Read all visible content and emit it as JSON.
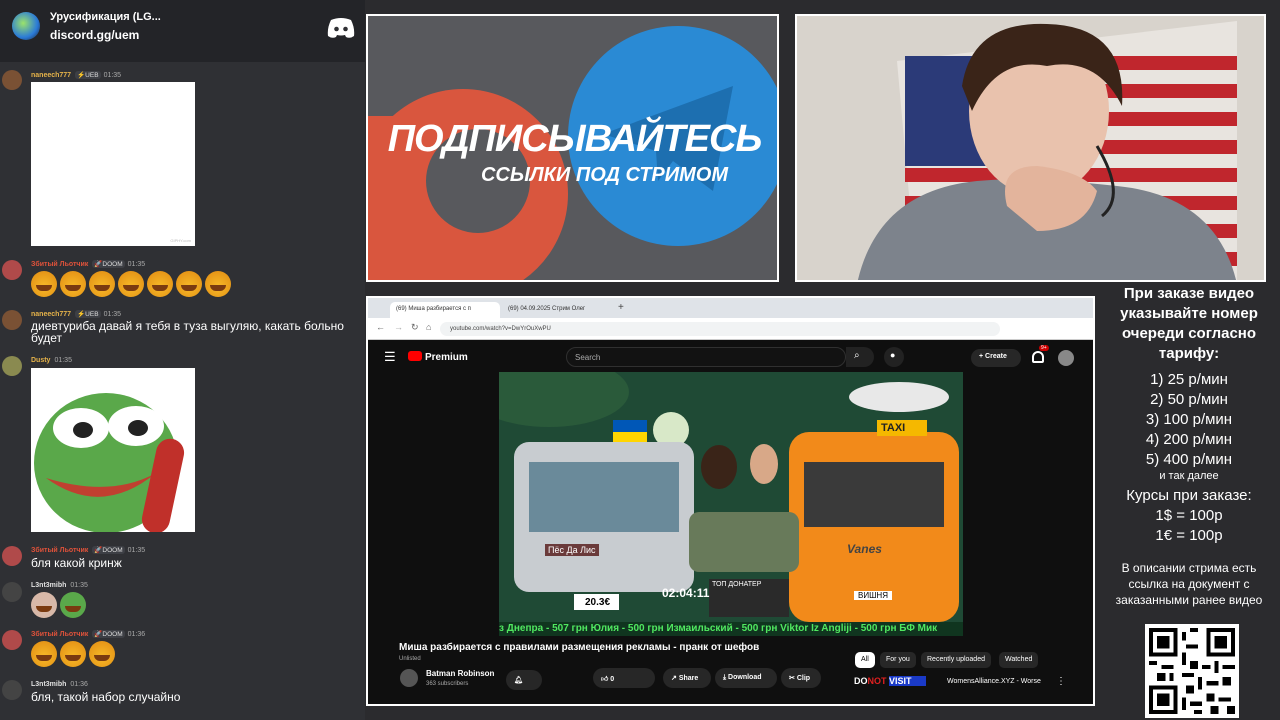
{
  "chat": {
    "server_name": "Урусификация (LG...",
    "server_link": "discord.gg/uem",
    "messages": [
      {
        "user": "naneech777",
        "badges": [
          "⚡UEB",
          "👥"
        ],
        "time": "01:35",
        "color": "#e6b34a"
      },
      {
        "user": "Збитый Льотчик",
        "badges": [
          "🚀DOOM",
          "👥"
        ],
        "time": "01:35",
        "color": "#e0523a"
      },
      {
        "user": "naneech777",
        "badges": [
          "⚡UEB",
          "👥"
        ],
        "time": "01:35",
        "color": "#e6b34a",
        "text": "диевтуриба давай я тебя в туза выгуляю, какать больно будет"
      },
      {
        "user": "Dusty",
        "badges": [
          "👥"
        ],
        "time": "01:35",
        "color": "#e6b34a"
      },
      {
        "user": "Збитый Льотчик",
        "badges": [
          "🚀DOOM",
          "👥"
        ],
        "time": "01:35",
        "color": "#e0523a",
        "text": "бля какой кринж"
      },
      {
        "user": "L3nt3mibh",
        "badges": [
          "💀"
        ],
        "time": "01:35",
        "color": "#e0e0e0"
      },
      {
        "user": "Збитый Льотчик",
        "badges": [
          "🚀DOOM",
          "👥"
        ],
        "time": "01:36",
        "color": "#e0523a"
      },
      {
        "user": "L3nt3mibh",
        "badges": [
          "💀"
        ],
        "time": "01:36",
        "color": "#e0e0e0",
        "text": "бля, такой набор случайно"
      }
    ],
    "white_image_caption": "GIPHY.com"
  },
  "promo": {
    "line1": "ПОДПИСЫВАЙТЕСЬ",
    "line2": "ССЫЛКИ ПОД СТРИМОМ"
  },
  "browser": {
    "tabs": [
      "(69) Миша разбирается с п",
      "(69) 04.09.2025 Стрим Олег"
    ],
    "url": "youtube.com/watch?v=DwYrOuXwPU",
    "yt_brand": "Premium",
    "search_placeholder": "Search",
    "create_label": "Create",
    "notif_count": "9+",
    "video": {
      "ticker": "з Днепра - 507 грн   Юлия - 500 грн   Измаильский - 500 грн   Viktor Iz Angliji - 500 грн   БФ Мик",
      "timer": "02:04:11",
      "taxi_label": "TAXI",
      "sign_label": "Пёс Да Лис",
      "top_donator": "ТОП ДОНАТЕР",
      "plate": "ВИШНЯ",
      "bus_brand": "Vanes",
      "score": "20.3€"
    },
    "title": "Миша разбирается с правилами размещения рекламы - пранк от шефов",
    "unlisted": "Unlisted",
    "channel": "Batman Robinson",
    "subscribers": "363 subscribers",
    "likes": "0",
    "buttons": {
      "share": "Share",
      "download": "Download",
      "clip": "Clip"
    },
    "chips": [
      "All",
      "For you",
      "Recently uploaded",
      "Watched"
    ],
    "ad_logo": {
      "do": "DO",
      "not": "NOT",
      "visit": "VISIT"
    },
    "ad_text": "WomensAlliance.XYZ - Worse"
  },
  "pricing": {
    "header": "При заказе видео указывайте номер очереди согласно тарифу:",
    "tiers": [
      "1) 25 р/мин",
      "2) 50 р/мин",
      "3) 100 р/мин",
      "4) 200 р/мин",
      "5) 400 р/мин"
    ],
    "etc": "и так далее",
    "rates_header": "Курсы при заказе:",
    "rates": [
      "1$ = 100р",
      "1€ = 100р"
    ],
    "note": "В описании стрима есть ссылка на документ с заказанными ранее видео"
  }
}
